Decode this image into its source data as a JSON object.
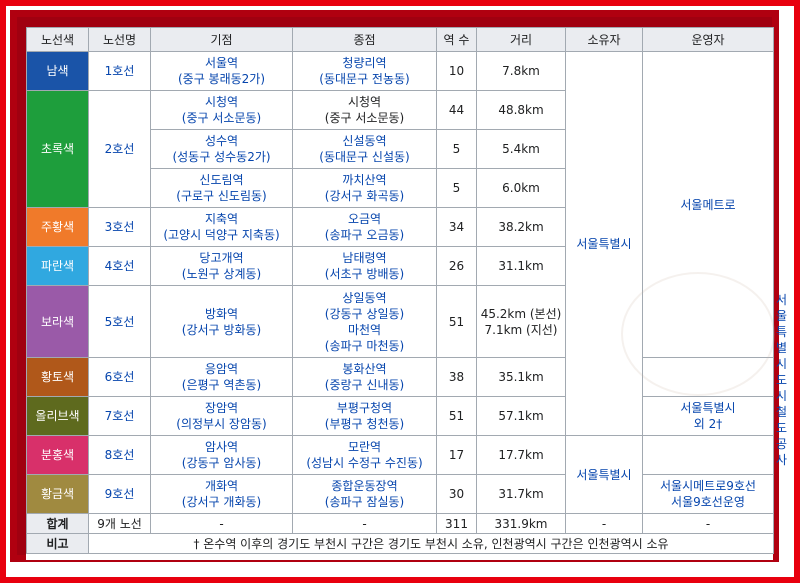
{
  "headers": [
    "노선색",
    "노선명",
    "기점",
    "종점",
    "역 수",
    "거리",
    "소유자",
    "운영자"
  ],
  "colors": {
    "blue": "#1a54a8",
    "green": "#1e9e3c",
    "orange": "#f07a2a",
    "skyblue": "#30a8e0",
    "purple": "#9a5aa8",
    "brown": "#b0581a",
    "olive": "#5e6a1e",
    "pink": "#d8306a",
    "gold": "#a08a40"
  },
  "lines": {
    "l1": {
      "color": "남색",
      "name": "1호선",
      "start_a": "서울역",
      "start_b": "(중구 봉래동2가)",
      "end_a": "청량리역",
      "end_b": "(동대문구 전농동)",
      "stations": "10",
      "distance": "7.8km"
    },
    "l2": {
      "color": "초록색",
      "name": "2호선",
      "rows": [
        {
          "start_a": "시청역",
          "start_b": "(중구 서소문동)",
          "end_a": "시청역",
          "end_b": "(중구 서소문동)",
          "stations": "44",
          "distance": "48.8km"
        },
        {
          "start_a": "성수역",
          "start_b": "(성동구 성수동2가)",
          "end_a": "신설동역",
          "end_b": "(동대문구 신설동)",
          "stations": "5",
          "distance": "5.4km"
        },
        {
          "start_a": "신도림역",
          "start_b": "(구로구 신도림동)",
          "end_a": "까치산역",
          "end_b": "(강서구 화곡동)",
          "stations": "5",
          "distance": "6.0km"
        }
      ]
    },
    "l3": {
      "color": "주황색",
      "name": "3호선",
      "start_a": "지축역",
      "start_b": "(고양시 덕양구 지축동)",
      "end_a": "오금역",
      "end_b": "(송파구 오금동)",
      "stations": "34",
      "distance": "38.2km"
    },
    "l4": {
      "color": "파란색",
      "name": "4호선",
      "start_a": "당고개역",
      "start_b": "(노원구 상계동)",
      "end_a": "남태령역",
      "end_b": "(서초구 방배동)",
      "stations": "26",
      "distance": "31.1km"
    },
    "l5": {
      "color": "보라색",
      "name": "5호선",
      "start_a": "방화역",
      "start_b": "(강서구 방화동)",
      "end_a": "상일동역",
      "end_b": "(강동구 상일동)",
      "end_c": "마천역",
      "end_d": "(송파구 마천동)",
      "stations": "51",
      "distance_a": "45.2km (본선)",
      "distance_b": "7.1km (지선)"
    },
    "l6": {
      "color": "황토색",
      "name": "6호선",
      "start_a": "응암역",
      "start_b": "(은평구 역촌동)",
      "end_a": "봉화산역",
      "end_b": "(중랑구 신내동)",
      "stations": "38",
      "distance": "35.1km"
    },
    "l7": {
      "color": "올리브색",
      "name": "7호선",
      "start_a": "장암역",
      "start_b": "(의정부시 장암동)",
      "end_a": "부평구청역",
      "end_b": "(부평구 청천동)",
      "stations": "51",
      "distance": "57.1km"
    },
    "l8": {
      "color": "분홍색",
      "name": "8호선",
      "start_a": "암사역",
      "start_b": "(강동구 암사동)",
      "end_a": "모란역",
      "end_b": "(성남시 수정구 수진동)",
      "stations": "17",
      "distance": "17.7km"
    },
    "l9": {
      "color": "황금색",
      "name": "9호선",
      "start_a": "개화역",
      "start_b": "(강서구 개화동)",
      "end_a": "종합운동장역",
      "end_b": "(송파구 잠실동)",
      "stations": "30",
      "distance": "31.7km"
    }
  },
  "owners": {
    "seoul": "서울특별시",
    "l7_a": "서울특별시",
    "l7_b": "외 2†",
    "l89": "서울특별시"
  },
  "operators": {
    "metro": "서울메트로",
    "smrt_a": "서울특별시",
    "smrt_b": "도시철도공사",
    "l9_a": "서울시메트로9호선",
    "l9_b": "서울9호선운영"
  },
  "total": {
    "label": "합계",
    "lines": "9개 노선",
    "start": "-",
    "end": "-",
    "stations": "311",
    "distance": "331.9km",
    "owner": "-",
    "operator": "-"
  },
  "note": {
    "label": "비고",
    "text": "† 온수역 이후의 경기도 부천시 구간은 경기도 부천시 소유, 인천광역시 구간은 인천광역시 소유"
  }
}
